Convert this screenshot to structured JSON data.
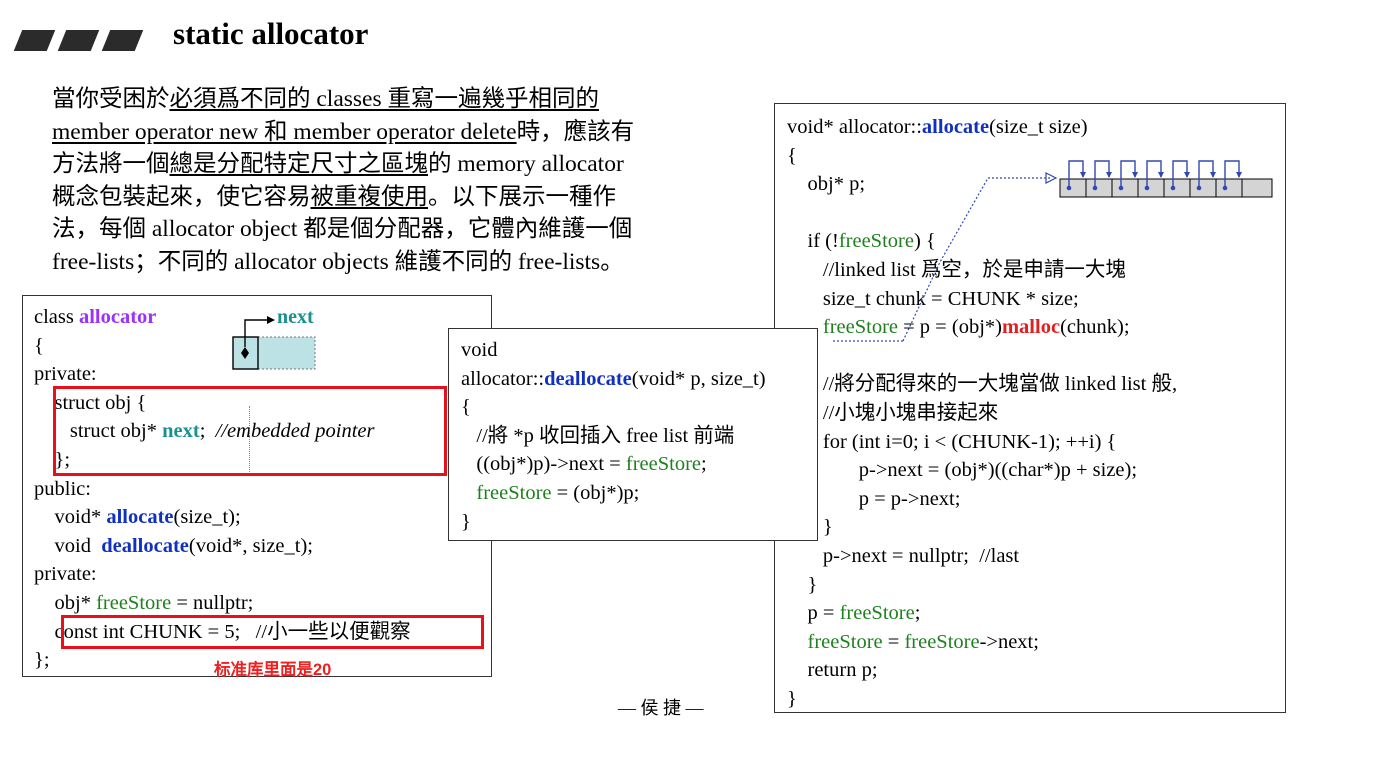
{
  "header": {
    "title": "static allocator"
  },
  "intro": {
    "l1_a": "當你受困於",
    "l1_b": "必須爲不同的 classes 重寫一遍幾乎相同的",
    "l2_a": "member operator new 和 member operator delete",
    "l2_b": "時，應該有",
    "l3_a": "方法將一個",
    "l3_b": "總是分配特定尺寸之區塊",
    "l3_c": "的 memory allocator",
    "l4_a": "概念包裝起來，使它容易",
    "l4_b": "被重複使用",
    "l4_c": "。以下展示一種作",
    "l5": "法，每個 allocator object 都是個分配器，它體內維護一個",
    "l6": "free-lists；不同的 allocator objects 維護不同的 free-lists。"
  },
  "class_box": {
    "l1_a": "class ",
    "l1_b": "allocator",
    "l2": "{",
    "l3": "private:",
    "l4": "    struct obj {",
    "l5_a": "       struct obj* ",
    "l5_b": "next",
    "l5_c": ";  ",
    "l5_d": "//embedded pointer",
    "l6": "    };",
    "l7": "public:",
    "l8_a": "    void* ",
    "l8_b": "allocate",
    "l8_c": "(size_t);",
    "l9_a": "    void  ",
    "l9_b": "deallocate",
    "l9_c": "(void*, size_t);",
    "l10": "private:",
    "l11_a": "    obj* ",
    "l11_b": "freeStore",
    "l11_c": " = nullptr;",
    "l12": "    const int CHUNK = 5;   //小一些以便觀察",
    "l13": "};",
    "diagram_label": "next",
    "note": "标准库里面是20"
  },
  "dealloc_box": {
    "l1": "void",
    "l2_a": "allocator::",
    "l2_b": "deallocate",
    "l2_c": "(void* p, size_t)",
    "l3": "{",
    "l4": "   //將 *p 收回插入 free list 前端",
    "l5_a": "   ((obj*)p)->next = ",
    "l5_b": "freeStore",
    "l5_c": ";",
    "l6_a": "   ",
    "l6_b": "freeStore",
    "l6_c": " = (obj*)p;",
    "l7": "}"
  },
  "alloc_box": {
    "l1_a": "void* allocator::",
    "l1_b": "allocate",
    "l1_c": "(size_t size)",
    "l2": "{",
    "l3": "    obj* p;",
    "l4_a": "    if (!",
    "l4_b": "freeStore",
    "l4_c": ") {",
    "l5": "       //linked list 爲空，於是申請一大塊",
    "l6": "       size_t chunk = CHUNK * size;",
    "l7_a": "       ",
    "l7_b": "freeStore",
    "l7_c": " = p = (obj*)",
    "l7_d": "malloc",
    "l7_e": "(chunk);",
    "l8": "",
    "l9": "       //將分配得來的一大塊當做 linked list 般,",
    "l10": "       //小塊小塊串接起來",
    "l11": "       for (int i=0; i < (CHUNK-1); ++i) {",
    "l12": "              p->next = (obj*)((char*)p + size);",
    "l13": "              p = p->next;",
    "l14": "       }",
    "l15": "       p->next = nullptr;  //last",
    "l16": "    }",
    "l17_a": "    p = ",
    "l17_b": "freeStore",
    "l17_c": ";",
    "l18_a": "    ",
    "l18_b": "freeStore",
    "l18_c": " = ",
    "l18_d": "freeStore",
    "l18_e": "->next;",
    "l19": "    return p;",
    "l20": "}"
  },
  "footer": {
    "text": "— 侯 捷 —"
  },
  "colors": {
    "purple": "#9b30ff",
    "teal": "#1a9090",
    "blue": "#1030c0",
    "green": "#208020",
    "red": "#e02020",
    "frame": "#e8101a"
  }
}
